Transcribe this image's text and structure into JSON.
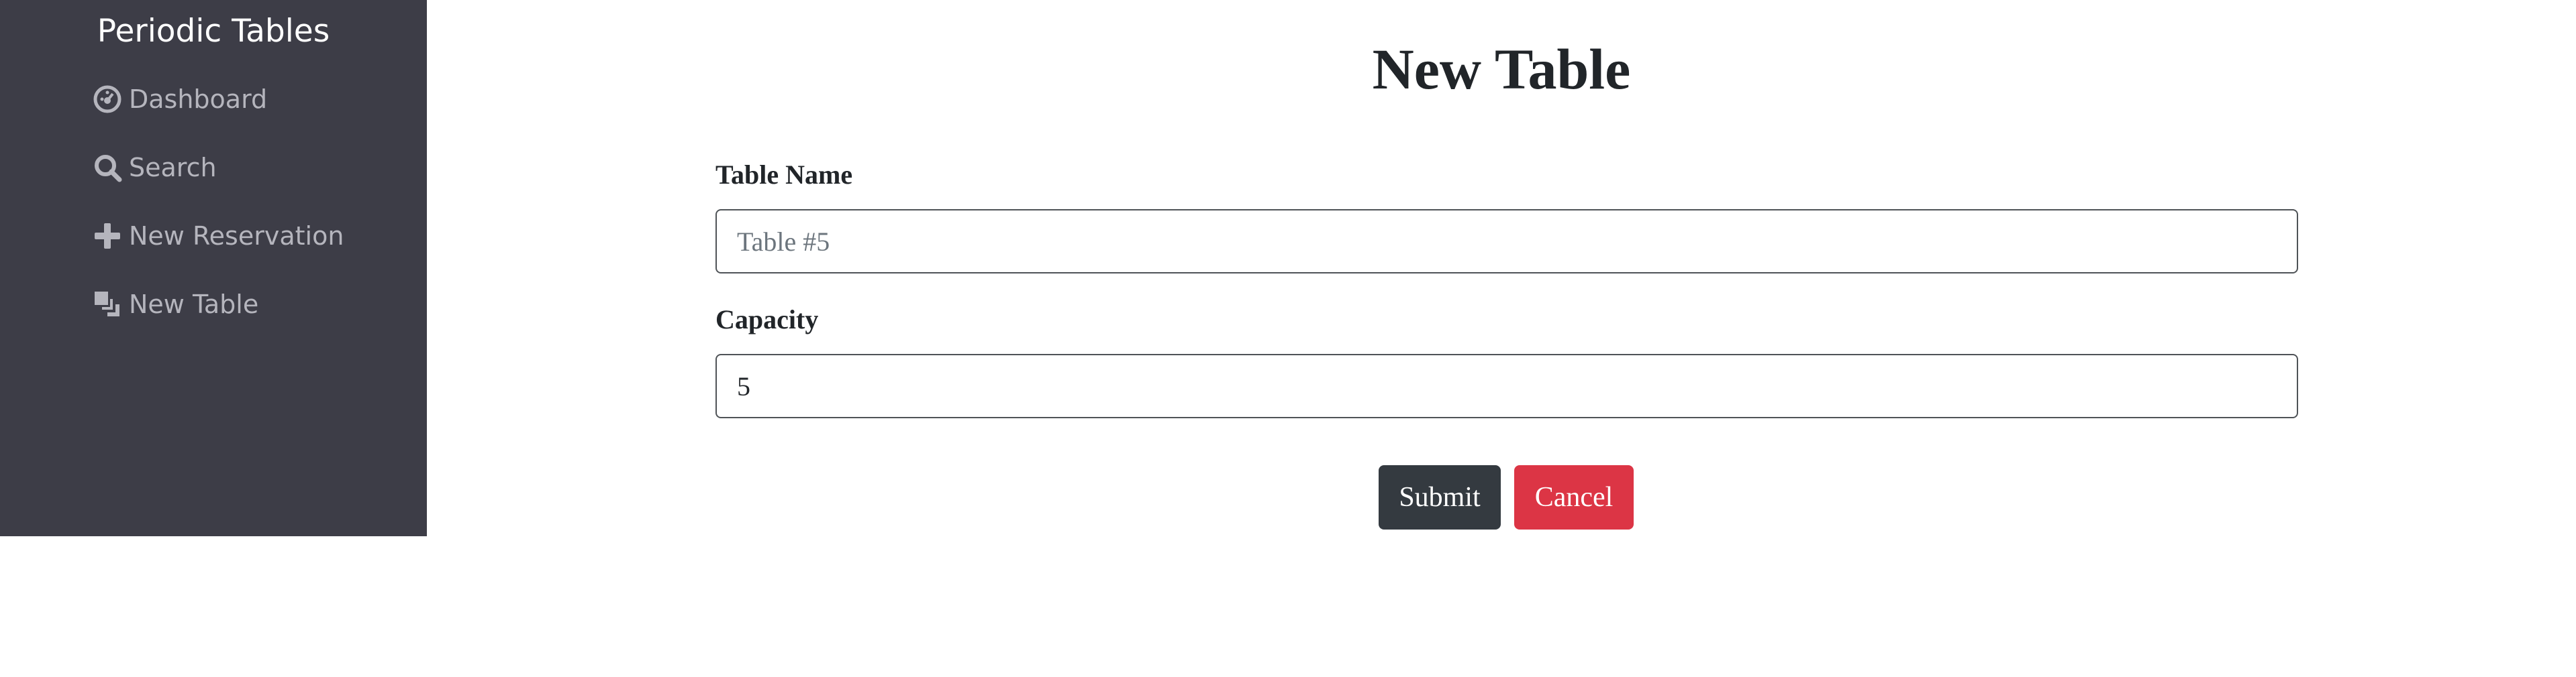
{
  "sidebar": {
    "brand": "Periodic Tables",
    "items": [
      {
        "label": "Dashboard",
        "icon": "dashboard-icon"
      },
      {
        "label": "Search",
        "icon": "search-icon"
      },
      {
        "label": "New Reservation",
        "icon": "plus-icon"
      },
      {
        "label": "New Table",
        "icon": "table-icon"
      }
    ],
    "background_color": "#3d3d47"
  },
  "main": {
    "title": "New Table",
    "form": {
      "table_name_label": "Table Name",
      "table_name_placeholder": "Table #5",
      "table_name_value": "",
      "capacity_label": "Capacity",
      "capacity_value": "5",
      "submit_label": "Submit",
      "cancel_label": "Cancel"
    }
  },
  "colors": {
    "submit_button": "#343a40",
    "cancel_button": "#dc3545"
  }
}
